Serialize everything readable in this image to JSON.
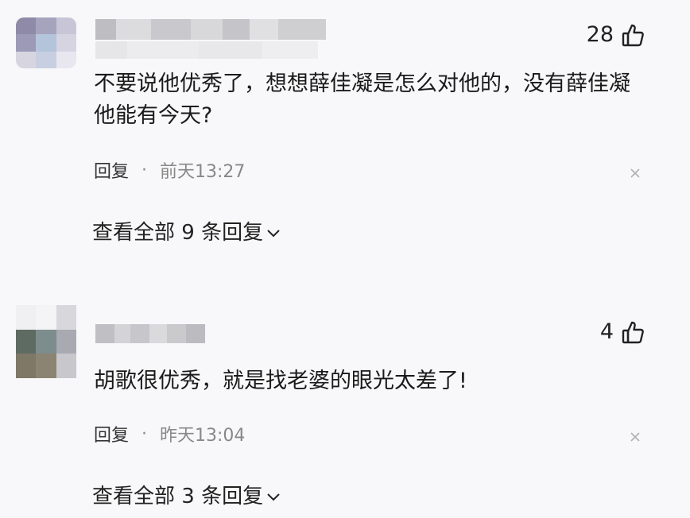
{
  "comments": [
    {
      "likes": "28",
      "text": "不要说他优秀了，想想薛佳凝是怎么对他的，没有薛佳凝他能有今天?",
      "reply_label": "回复",
      "dot": "·",
      "time": "前天13:27",
      "more_label": "查看全部 9 条回复"
    },
    {
      "likes": "4",
      "text": "胡歌很优秀，就是找老婆的眼光太差了!",
      "reply_label": "回复",
      "dot": "·",
      "time": "昨天13:04",
      "more_label": "查看全部 3 条回复"
    }
  ],
  "icons": {
    "like": "thumbs-up-icon",
    "close": "close-icon",
    "expand": "chevron-down-icon"
  }
}
